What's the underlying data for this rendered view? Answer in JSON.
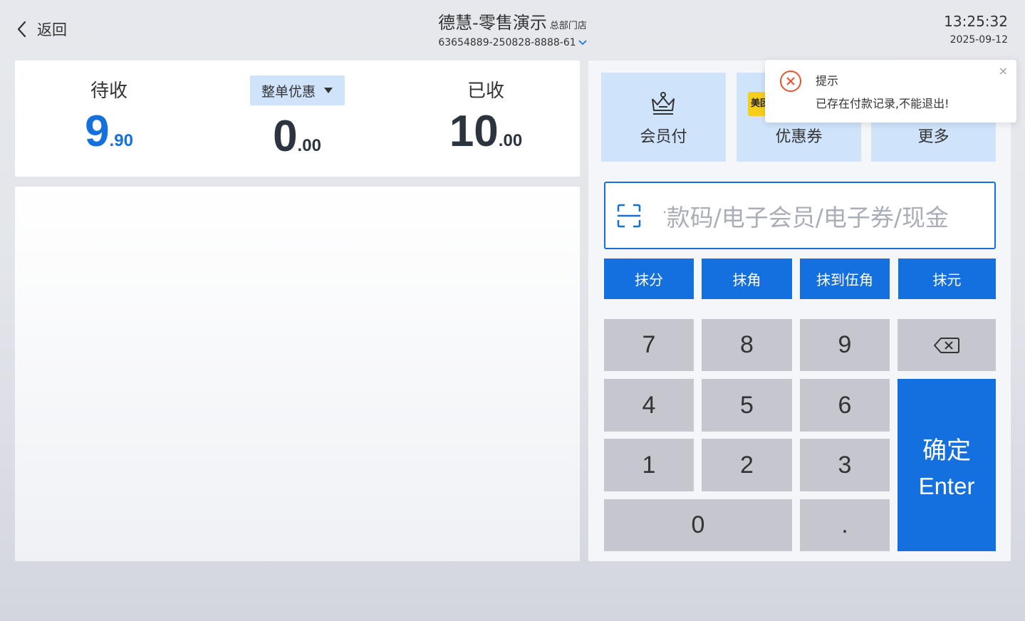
{
  "header": {
    "back_label": "返回",
    "store_title": "德慧-零售演示",
    "store_sub": "总部门店",
    "order_id": "63654889-250828-8888-61",
    "time": "13:25:32",
    "date": "2025-09-12"
  },
  "summary": {
    "pending_label": "待收",
    "pending_int": "9",
    "pending_dec": ".90",
    "discount_label": "整单优惠",
    "discount_int": "0",
    "discount_dec": ".00",
    "received_label": "已收",
    "received_int": "10",
    "received_dec": ".00"
  },
  "payment_methods": {
    "member_label": "会员付",
    "coupon_badge": "美团",
    "coupon_label": "优惠券",
    "more_label": "更多"
  },
  "scan": {
    "placeholder": "付款码/电子会员/电子券/现金"
  },
  "rounding": {
    "fen": "抹分",
    "jiao": "抹角",
    "wujiao": "抹到伍角",
    "yuan": "抹元"
  },
  "keypad": {
    "k7": "7",
    "k8": "8",
    "k9": "9",
    "k4": "4",
    "k5": "5",
    "k6": "6",
    "k1": "1",
    "k2": "2",
    "k3": "3",
    "k0": "0",
    "kdot": ".",
    "confirm_cn": "确定",
    "confirm_en": "Enter"
  },
  "toast": {
    "title": "提示",
    "message": "已存在付款记录,不能退出!",
    "close": "×"
  },
  "colors": {
    "accent": "#1570df",
    "tile_bg": "#cfe3fb",
    "key_bg": "#c5c6ce",
    "error": "#e8542f"
  }
}
